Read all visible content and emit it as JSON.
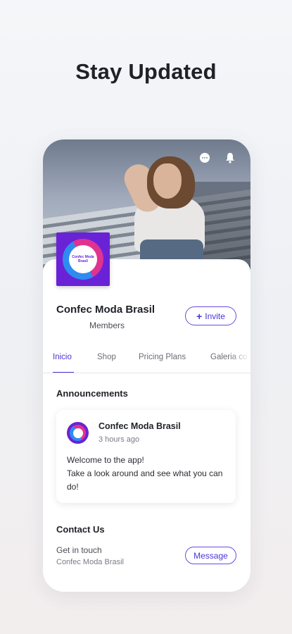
{
  "headline": "Stay Updated",
  "header": {
    "icons": [
      "chat-icon",
      "bell-icon"
    ]
  },
  "site": {
    "name": "Confec Moda Brasil",
    "members_label": "Members",
    "invite_label": "Invite",
    "logo_text": "Confec Moda Brasil"
  },
  "tabs": [
    {
      "label": "Inicio",
      "active": true
    },
    {
      "label": "Shop",
      "active": false
    },
    {
      "label": "Pricing Plans",
      "active": false
    },
    {
      "label": "Galeria co",
      "active": false
    }
  ],
  "announcements": {
    "title": "Announcements",
    "post": {
      "author": "Confec Moda Brasil",
      "time": "3 hours ago",
      "body_line1": "Welcome to the app!",
      "body_line2": "Take a look around and see what you can do!"
    }
  },
  "contact": {
    "title": "Contact Us",
    "subtitle": "Get in touch",
    "name": "Confec Moda Brasil",
    "message_label": "Message"
  },
  "colors": {
    "accent": "#4a35d6",
    "logo_bg": "#6a22d6",
    "logo_pink": "#e0338f",
    "logo_blue": "#2e8bf0"
  }
}
